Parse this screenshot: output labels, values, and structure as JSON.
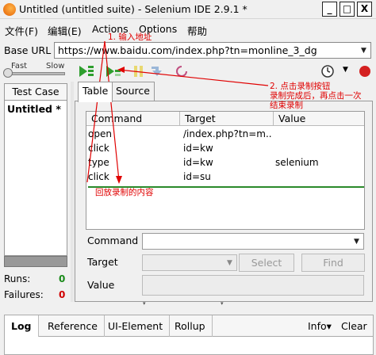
{
  "window": {
    "title": "Untitled (untitled suite) - Selenium IDE 2.9.1 *",
    "minimize": "_",
    "maximize": "□",
    "close": "X"
  },
  "menu": [
    "文件(F)",
    "编辑(E)",
    "Actions",
    "Options",
    "帮助"
  ],
  "base_url": {
    "label": "Base URL",
    "value": "https://www.baidu.com/index.php?tn=monline_3_dg"
  },
  "speed": {
    "fast": "Fast",
    "slow": "Slow",
    "level": 0.0
  },
  "toolbar_icons": [
    "play-all-icon",
    "play-current-icon",
    "pause-icon",
    "step-icon",
    "rollup-icon",
    "schedule-icon",
    "record-icon"
  ],
  "test_case_panel": {
    "header": "Test Case",
    "items": [
      "Untitled *"
    ],
    "runs_label": "Runs:",
    "runs": "0",
    "failures_label": "Failures:",
    "failures": "0"
  },
  "tabs": [
    "Table",
    "Source"
  ],
  "table": {
    "columns": [
      "Command",
      "Target",
      "Value"
    ],
    "rows": [
      [
        "open",
        "/index.php?tn=m...",
        ""
      ],
      [
        "click",
        "id=kw",
        ""
      ],
      [
        "type",
        "id=kw",
        "selenium"
      ],
      [
        "click",
        "id=su",
        ""
      ]
    ]
  },
  "editor": {
    "command_label": "Command",
    "target_label": "Target",
    "value_label": "Value",
    "select_button": "Select",
    "find_button": "Find"
  },
  "bottom_tabs": [
    "Log",
    "Reference",
    "UI-Element",
    "Rollup"
  ],
  "bottom_right": {
    "info": "Info▾",
    "clear": "Clear"
  },
  "annotations": {
    "a1": "1. 输入地址",
    "a2_line1": "2. 点击录制按钮",
    "a2_line2": "录制完成后，再点击一次",
    "a2_line3": "结束录制",
    "a3": "回放录制的内容"
  },
  "colors": {
    "annotation": "#e00000",
    "play_green": "#2e9e2e",
    "record_red": "#d42020",
    "status_green": "#1a8a1a",
    "status_red": "#d00000"
  }
}
